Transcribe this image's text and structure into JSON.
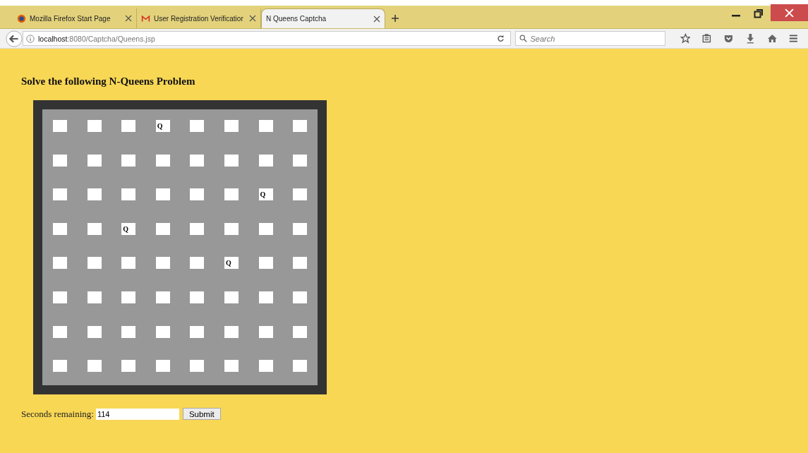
{
  "tabs": [
    {
      "label": "Mozilla Firefox Start Page",
      "selected": false
    },
    {
      "label": "User Registration Verificatior",
      "selected": false
    },
    {
      "label": "N Queens Captcha",
      "selected": true
    }
  ],
  "address": {
    "host": "localhost",
    "path": ":8080/Captcha/Queens.jsp"
  },
  "search": {
    "placeholder": "Search"
  },
  "heading": "Solve the following N-Queens Problem",
  "board": [
    [
      {
        "kind": "empty"
      },
      {
        "kind": "empty"
      },
      {
        "kind": "empty"
      },
      {
        "kind": "queen",
        "value": "Q"
      },
      {
        "kind": "empty"
      },
      {
        "kind": "empty"
      },
      {
        "kind": "empty"
      },
      {
        "kind": "empty"
      }
    ],
    [
      {
        "kind": "empty"
      },
      {
        "kind": "empty"
      },
      {
        "kind": "empty"
      },
      {
        "kind": "empty"
      },
      {
        "kind": "empty"
      },
      {
        "kind": "empty"
      },
      {
        "kind": "empty"
      },
      {
        "kind": "empty"
      }
    ],
    [
      {
        "kind": "empty"
      },
      {
        "kind": "empty"
      },
      {
        "kind": "empty"
      },
      {
        "kind": "empty"
      },
      {
        "kind": "empty"
      },
      {
        "kind": "empty"
      },
      {
        "kind": "queen",
        "value": "Q"
      },
      {
        "kind": "empty"
      }
    ],
    [
      {
        "kind": "empty"
      },
      {
        "kind": "empty"
      },
      {
        "kind": "queen",
        "value": "Q"
      },
      {
        "kind": "empty"
      },
      {
        "kind": "empty"
      },
      {
        "kind": "empty"
      },
      {
        "kind": "empty"
      },
      {
        "kind": "empty"
      }
    ],
    [
      {
        "kind": "empty"
      },
      {
        "kind": "empty"
      },
      {
        "kind": "empty"
      },
      {
        "kind": "empty"
      },
      {
        "kind": "empty"
      },
      {
        "kind": "queen",
        "value": "Q"
      },
      {
        "kind": "empty"
      },
      {
        "kind": "empty"
      }
    ],
    [
      {
        "kind": "empty"
      },
      {
        "kind": "empty"
      },
      {
        "kind": "empty"
      },
      {
        "kind": "empty"
      },
      {
        "kind": "empty"
      },
      {
        "kind": "empty"
      },
      {
        "kind": "empty"
      },
      {
        "kind": "empty"
      }
    ],
    [
      {
        "kind": "empty"
      },
      {
        "kind": "empty"
      },
      {
        "kind": "empty"
      },
      {
        "kind": "empty"
      },
      {
        "kind": "empty"
      },
      {
        "kind": "empty"
      },
      {
        "kind": "empty"
      },
      {
        "kind": "empty"
      }
    ],
    [
      {
        "kind": "empty"
      },
      {
        "kind": "empty"
      },
      {
        "kind": "empty"
      },
      {
        "kind": "empty"
      },
      {
        "kind": "empty"
      },
      {
        "kind": "empty"
      },
      {
        "kind": "empty"
      },
      {
        "kind": "empty"
      }
    ]
  ],
  "timer": {
    "label": "Seconds remaining:",
    "value": "114"
  },
  "submit": "Submit"
}
